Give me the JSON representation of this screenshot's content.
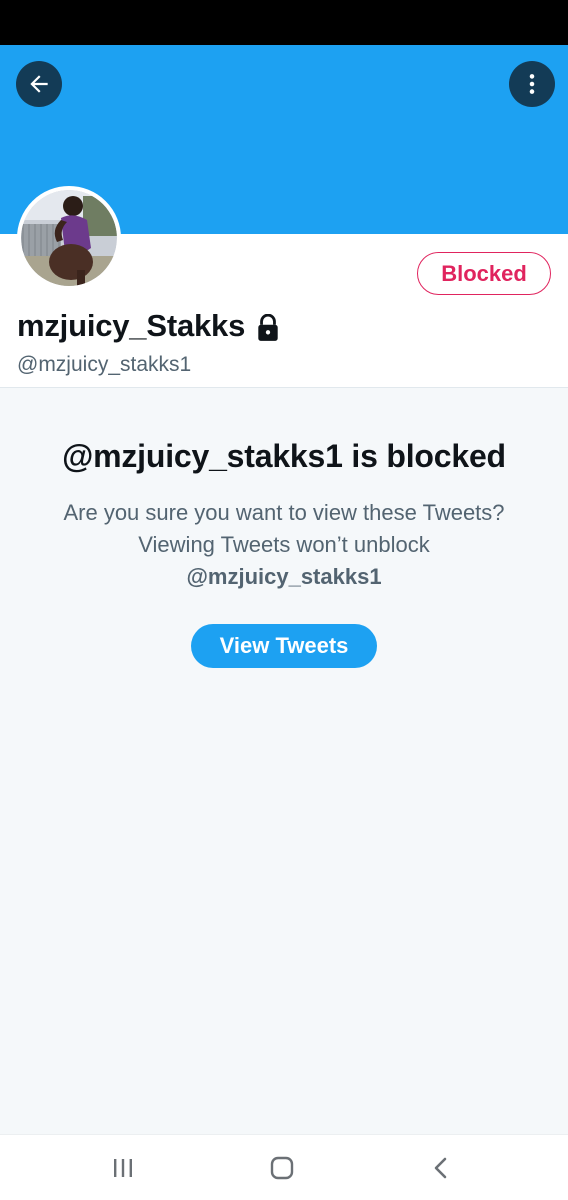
{
  "header": {
    "back_icon": "arrow-left-icon",
    "more_icon": "more-vertical-icon",
    "banner_color": "#1da1f2"
  },
  "profile": {
    "display_name": "mzjuicy_Stakks",
    "handle": "@mzjuicy_stakks1",
    "protected_icon": "lock-icon",
    "blocked_label": "Blocked"
  },
  "blocked_notice": {
    "title": "@mzjuicy_stakks1 is blocked",
    "description": "Are you sure you want to view these Tweets? Viewing Tweets won’t unblock",
    "description_handle": "@mzjuicy_stakks1",
    "button_label": "View Tweets"
  },
  "system_nav": {
    "recents_icon": "recents-icon",
    "home_icon": "home-icon",
    "back_icon": "chevron-left-icon"
  },
  "colors": {
    "accent": "#1da1f2",
    "blocked_red": "#e0245e",
    "text_primary": "#0f1419",
    "text_secondary": "#536471"
  }
}
